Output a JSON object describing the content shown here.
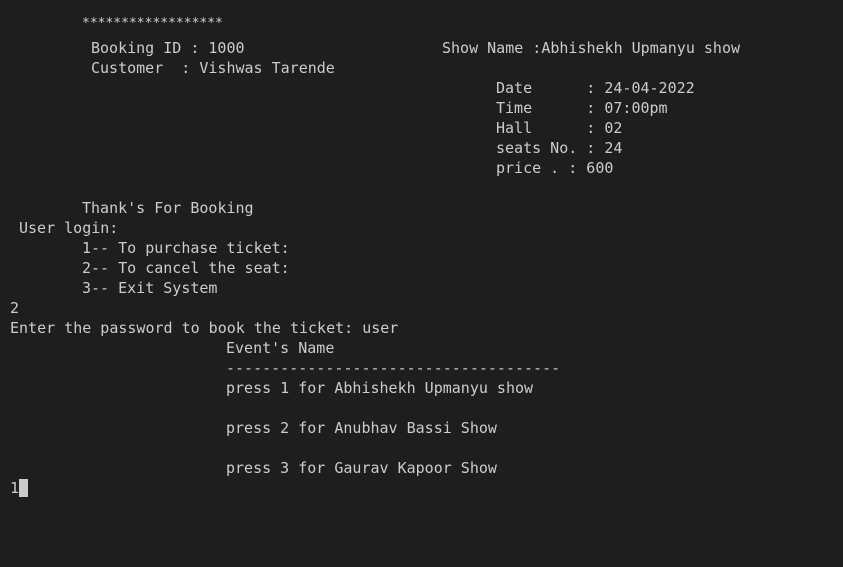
{
  "terminal": {
    "receipt": {
      "stars": "******************",
      "booking_id": "Booking ID : 1000",
      "show_name": "Show Name :Abhishekh Upmanyu show",
      "customer": "Customer  : Vishwas Tarende",
      "date": "Date      : 24-04-2022",
      "time": "Time      : 07:00pm",
      "hall": "Hall      : 02",
      "seats": "seats No. : 24",
      "price": "price . : 600"
    },
    "thanks": "Thank's For Booking",
    "user_login": "User login:",
    "menu": [
      "1-- To purchase ticket:",
      "2-- To cancel the seat:",
      "3-- Exit System"
    ],
    "choice": "2",
    "password_prompt": "Enter the password to book the ticket: user",
    "events_title": "Event's Name",
    "events_divider": "-------------------------------------",
    "events": [
      "press 1 for Abhishekh Upmanyu show",
      "press 2 for Anubhav Bassi Show",
      "press 3 for Gaurav Kapoor Show"
    ],
    "current_input": "1"
  }
}
